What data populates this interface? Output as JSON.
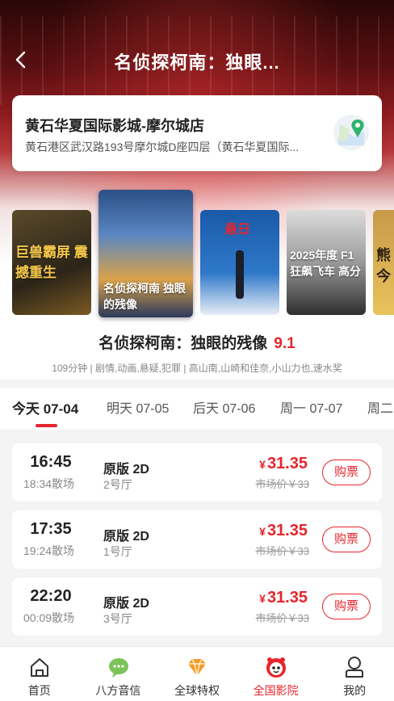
{
  "header": {
    "title": "名侦探柯南：独眼..."
  },
  "cinema": {
    "name": "黄石华夏国际影城-摩尔城店",
    "address": "黄石港区武汉路193号摩尔城D座四层（黄石华夏国际...",
    "map_icon": "map-pin-icon"
  },
  "posters": [
    {
      "caption": "巨兽霸屏 震撼重生"
    },
    {
      "caption": "名侦探柯南 独眼的残像"
    },
    {
      "caption": "悬日"
    },
    {
      "caption": "2025年度 F1 狂飙飞车 高分"
    },
    {
      "caption": "熊 今"
    }
  ],
  "movie": {
    "title": "名侦探柯南：独眼的残像",
    "score": "9.1",
    "meta": "109分钟 | 剧情,动画,悬疑,犯罪 | 高山南,山崎和佳奈,小山力也,速水奖"
  },
  "tabs": [
    {
      "label": "今天 07-04"
    },
    {
      "label": "明天 07-05"
    },
    {
      "label": "后天 07-06"
    },
    {
      "label": "周一 07-07"
    },
    {
      "label": "周二"
    }
  ],
  "shows": [
    {
      "start": "16:45",
      "end": "18:34散场",
      "version": "原版 2D",
      "hall": "2号厅",
      "currency": "¥",
      "price": "31.35",
      "market_price": "市场价￥33",
      "buy": "购票"
    },
    {
      "start": "17:35",
      "end": "19:24散场",
      "version": "原版 2D",
      "hall": "1号厅",
      "currency": "¥",
      "price": "31.35",
      "market_price": "市场价￥33",
      "buy": "购票"
    },
    {
      "start": "22:20",
      "end": "00:09散场",
      "version": "原版 2D",
      "hall": "3号厅",
      "currency": "¥",
      "price": "31.35",
      "market_price": "市场价￥33",
      "buy": "购票"
    }
  ],
  "nav": [
    {
      "label": "首页",
      "icon": "home-icon"
    },
    {
      "label": "八方音信",
      "icon": "chat-icon"
    },
    {
      "label": "全球特权",
      "icon": "diamond-icon"
    },
    {
      "label": "全国影院",
      "icon": "cinema-mascot-icon"
    },
    {
      "label": "我的",
      "icon": "profile-icon"
    }
  ],
  "colors": {
    "accent": "#e6252d",
    "header_dark": "#5a0f12"
  }
}
